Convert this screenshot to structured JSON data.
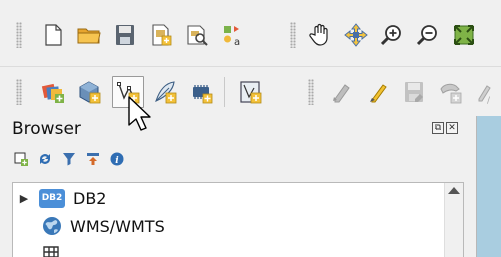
{
  "toolbar1": {
    "buttons": [
      {
        "name": "new-project-icon"
      },
      {
        "name": "open-project-icon"
      },
      {
        "name": "save-project-icon"
      },
      {
        "name": "new-print-layout-icon"
      },
      {
        "name": "show-layout-manager-icon"
      },
      {
        "name": "style-manager-icon"
      },
      {
        "name": "pan-map-icon"
      },
      {
        "name": "pan-to-selection-icon"
      },
      {
        "name": "zoom-in-icon"
      },
      {
        "name": "zoom-out-icon"
      },
      {
        "name": "zoom-full-icon"
      }
    ]
  },
  "toolbar2": {
    "buttons": [
      {
        "name": "data-source-manager-icon"
      },
      {
        "name": "new-geopackage-layer-icon"
      },
      {
        "name": "new-shapefile-layer-icon"
      },
      {
        "name": "new-temporary-scratch-layer-icon"
      },
      {
        "name": "new-virtual-layer-icon"
      },
      {
        "name": "new-mesh-layer-icon"
      },
      {
        "name": "current-edits-icon"
      },
      {
        "name": "toggle-editing-icon"
      },
      {
        "name": "save-layer-edits-icon"
      },
      {
        "name": "add-feature-icon"
      },
      {
        "name": "digitize-icon"
      }
    ]
  },
  "browser": {
    "title": "Browser",
    "float_glyph": "⧉",
    "close_glyph": "✕",
    "tools": [
      {
        "name": "add-selected-layers-icon"
      },
      {
        "name": "refresh-icon"
      },
      {
        "name": "filter-icon"
      },
      {
        "name": "collapse-all-icon"
      },
      {
        "name": "properties-icon"
      }
    ],
    "items": [
      {
        "label": "DB2",
        "badge": "DB2",
        "expand": "▶"
      },
      {
        "label": "WMS/WMTS",
        "expand": ""
      }
    ]
  },
  "colors": {
    "folder_yellow": "#f2b43a",
    "globe_blue": "#3a78b8",
    "db2_blue": "#4b8fd8",
    "map_canvas": "#a9cde0"
  }
}
